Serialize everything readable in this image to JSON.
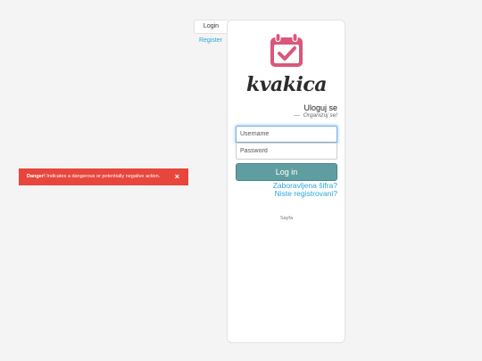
{
  "tabs": {
    "login": "Login",
    "register": "Register"
  },
  "brand": {
    "name": "kvakica",
    "icon": "calendar-check-icon",
    "accent": "#d9577b"
  },
  "form": {
    "heading": "Uloguj se",
    "dash": "—",
    "subheading": "Organizuj se!",
    "username_placeholder": "Username",
    "password_placeholder": "Password",
    "submit_label": "Log in",
    "forgot_link": "Zaboravljena šifra?",
    "register_link": "Niste registrovani?"
  },
  "footer": {
    "text": "Sayfa"
  },
  "alert": {
    "strong": "Danger!",
    "message": " Indicates a dangerous or potentially negative action.",
    "close": "×",
    "color": "#e8463d"
  },
  "colors": {
    "primary_button": "#5f9ea0",
    "link": "#2aa7d8"
  }
}
